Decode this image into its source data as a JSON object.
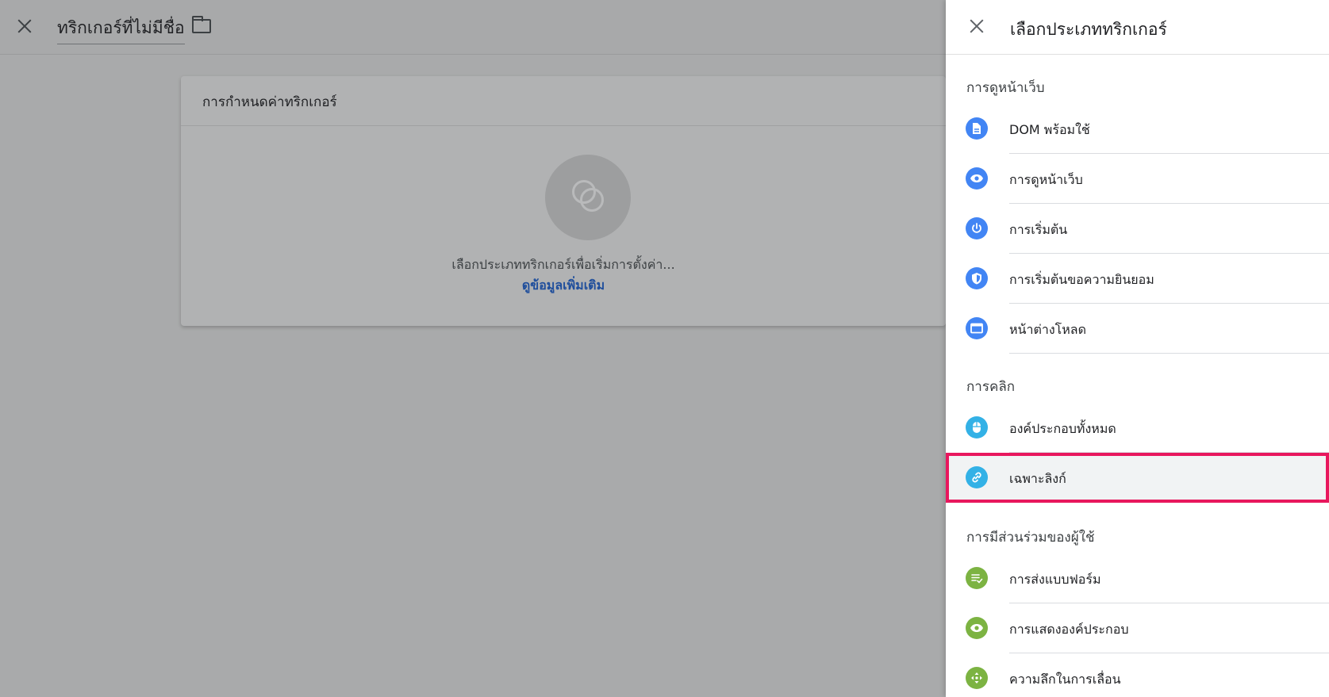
{
  "window": {
    "trigger_name": "ทริกเกอร์ที่ไม่มีชื่อ"
  },
  "config": {
    "header": "การกำหนดค่าทริกเกอร์",
    "message": "เลือกประเภททริกเกอร์เพื่อเริ่มการตั้งค่า...",
    "link": "ดูข้อมูลเพิ่มเติม"
  },
  "panel": {
    "title": "เลือกประเภททริกเกอร์",
    "sections": [
      {
        "title": "การดูหน้าเว็บ",
        "items": [
          {
            "label": "DOM พร้อมใช้",
            "icon": "document-icon",
            "color": "#4285f4"
          },
          {
            "label": "การดูหน้าเว็บ",
            "icon": "eye-icon",
            "color": "#4285f4"
          },
          {
            "label": "การเริ่มต้น",
            "icon": "power-icon",
            "color": "#4285f4"
          },
          {
            "label": "การเริ่มต้นขอความยินยอม",
            "icon": "shield-icon",
            "color": "#4285f4"
          },
          {
            "label": "หน้าต่างโหลด",
            "icon": "window-icon",
            "color": "#4285f4"
          }
        ]
      },
      {
        "title": "การคลิก",
        "items": [
          {
            "label": "องค์ประกอบทั้งหมด",
            "icon": "mouse-icon",
            "color": "#33b1e6"
          },
          {
            "label": "เฉพาะลิงก์",
            "icon": "link-icon",
            "color": "#33b1e6",
            "selected": true
          }
        ]
      },
      {
        "title": "การมีส่วนร่วมของผู้ใช้",
        "items": [
          {
            "label": "การส่งแบบฟอร์ม",
            "icon": "form-check-icon",
            "color": "#7cb342"
          },
          {
            "label": "การแสดงองค์ประกอบ",
            "icon": "eye-icon",
            "color": "#7cb342"
          },
          {
            "label": "ความลึกในการเลื่อน",
            "icon": "scroll-arrows-icon",
            "color": "#7cb342"
          }
        ]
      }
    ]
  },
  "colors": {
    "highlight": "#e8175d",
    "link": "#1f4e9c"
  }
}
